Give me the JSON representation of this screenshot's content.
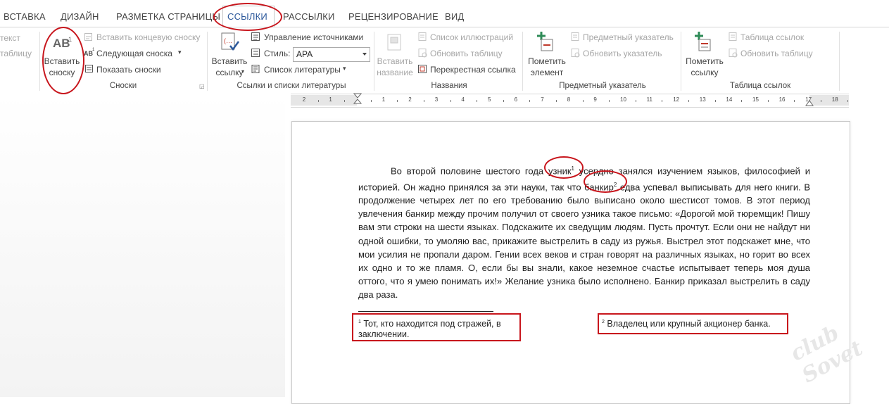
{
  "tabs": [
    {
      "label": "ВСТАВКА",
      "active": false
    },
    {
      "label": "ДИЗАЙН",
      "active": false
    },
    {
      "label": "РАЗМЕТКА СТРАНИЦЫ",
      "active": false
    },
    {
      "label": "ССЫЛКИ",
      "active": true
    },
    {
      "label": "РАССЫЛКИ",
      "active": false
    },
    {
      "label": "РЕЦЕНЗИРОВАНИЕ",
      "active": false
    },
    {
      "label": "ВИД",
      "active": false
    }
  ],
  "ribbon": {
    "toc": {
      "item1": "текст",
      "item2": "таблицу"
    },
    "footnotes": {
      "insert_footnote": "Вставить сноску",
      "insert_footnote_icon_text": "AB",
      "insert_footnote_icon_sup": "1",
      "insert_endnote": "Вставить концевую сноску",
      "next_footnote": "Следующая сноска",
      "next_footnote_icon_text": "AB",
      "next_footnote_icon_sup": "1",
      "show_notes": "Показать сноски",
      "group_label": "Сноски"
    },
    "citations": {
      "insert_citation": "Вставить ссылку",
      "manage_sources": "Управление источниками",
      "style_label": "Стиль:",
      "style_value": "APA",
      "bibliography": "Список литературы",
      "group_label": "Ссылки и списки литературы"
    },
    "captions": {
      "insert_caption": "Вставить название",
      "table_of_figures": "Список иллюстраций",
      "update_table": "Обновить таблицу",
      "cross_reference": "Перекрестная ссылка",
      "group_label": "Названия"
    },
    "index": {
      "mark_entry": "Пометить элемент",
      "insert_index": "Предметный указатель",
      "update_index": "Обновить указатель",
      "group_label": "Предметный указатель"
    },
    "toa": {
      "mark_citation": "Пометить ссылку",
      "insert_toa": "Таблица ссылок",
      "update_table": "Обновить таблицу",
      "group_label": "Таблица ссылок"
    }
  },
  "ruler_numbers": [
    "2",
    "1",
    "1",
    "2",
    "3",
    "4",
    "5",
    "6",
    "7",
    "8",
    "9",
    "10",
    "11",
    "12",
    "13",
    "14",
    "15",
    "16",
    "17",
    "18"
  ],
  "document": {
    "part1": "Во второй половине шестого года ",
    "word1": "узник",
    "ref1": "1",
    "part2": " усердно занялся изучением языков, философией и историей. Он жадно принялся за эти науки, так что ",
    "word2": "банкир",
    "ref2": "2",
    "part3": " едва успевал выписывать для него книги. В продолжение четырех лет по его требованию было выписано около шестисот томов. В этот период увлечения банкир между прочим получил от своего узника такое письмо: «Дорогой мой тюремщик! Пишу вам эти строки на шести языках. Подскажите их сведущим людям. Пусть прочтут. Если они не найдут ни одной ошибки, то умоляю вас, прикажите выстрелить в саду из ружья. Выстрел этот подскажет мне, что мои усилия не пропали даром. Гении всех веков и стран говорят на различных языках, но горит во всех их одно и то же пламя. О, если бы вы знали, какое неземное счастье испытывает теперь моя душа оттого, что я умею понимать их!» Желание узника было исполнено. Банкир приказал выстрелить в саду два раза.",
    "footnote1_num": "1",
    "footnote1_text": " Тот, кто находится под стражей, в заключении.",
    "footnote2_num": "2",
    "footnote2_text": " Владелец или крупный акционер банка."
  },
  "watermark": "club Sovet",
  "colors": {
    "accent": "#2b579a",
    "annotation": "#c8161d",
    "icon_red": "#c0392b",
    "icon_green": "#2e8b57"
  }
}
